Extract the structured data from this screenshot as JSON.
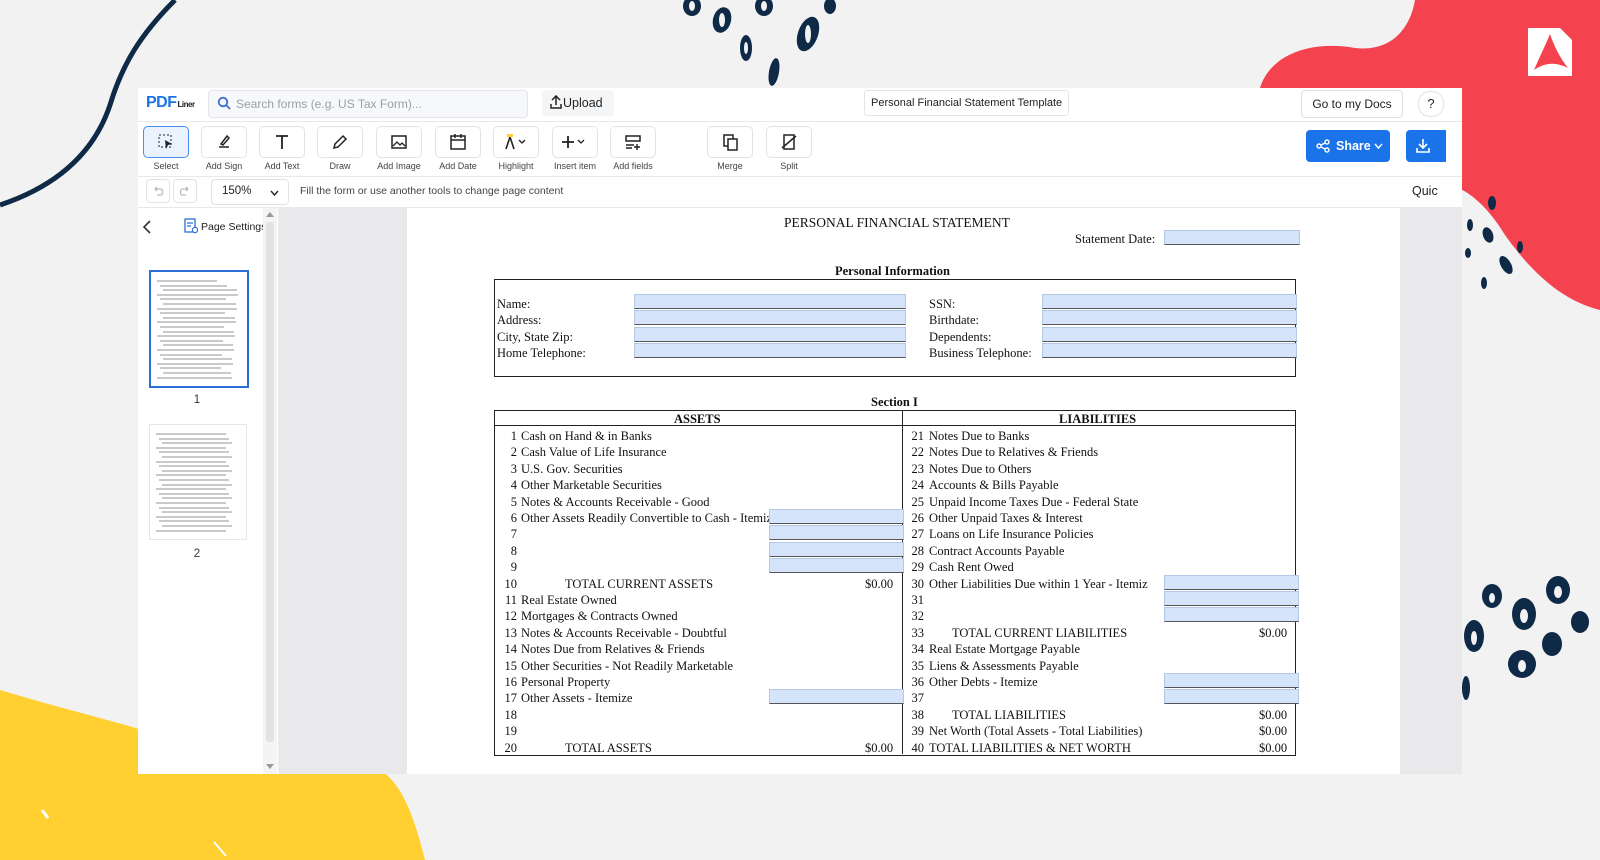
{
  "app": {
    "logo": {
      "text": "PDF",
      "suffix": "Liner"
    },
    "search": {
      "placeholder": "Search forms (e.g. US Tax Form)..."
    },
    "upload_label": "Upload",
    "document_title": "Personal Financial Statement Template",
    "go_to_docs_label": "Go to my Docs",
    "help_label": "?"
  },
  "toolbar": {
    "tools": [
      {
        "label": "Select",
        "icon": "select-icon"
      },
      {
        "label": "Add Sign",
        "icon": "sign-icon"
      },
      {
        "label": "Add Text",
        "icon": "text-icon"
      },
      {
        "label": "Draw",
        "icon": "pen-icon"
      },
      {
        "label": "Add Image",
        "icon": "image-icon"
      },
      {
        "label": "Add Date",
        "icon": "calendar-icon"
      },
      {
        "label": "Highlight",
        "icon": "highlight-icon"
      },
      {
        "label": "Insert item",
        "icon": "plus-icon"
      },
      {
        "label": "Add fields",
        "icon": "fields-icon"
      },
      {
        "label": "Merge",
        "icon": "merge-icon"
      },
      {
        "label": "Split",
        "icon": "split-icon"
      }
    ],
    "share_label": "Share"
  },
  "subbar": {
    "zoom": "150%",
    "hint": "Fill the form or use another tools to change page content",
    "quick_label": "Quic"
  },
  "sidebar": {
    "page_settings_label": "Page Settings",
    "pages": [
      "1",
      "2"
    ]
  },
  "form": {
    "title": "PERSONAL FINANCIAL STATEMENT",
    "statement_date_label": "Statement Date:",
    "personal_info_heading": "Personal Information",
    "personal_left": [
      "Name:",
      "Address:",
      "City, State Zip:",
      "Home Telephone:"
    ],
    "personal_right": [
      "SSN:",
      "Birthdate:",
      "Dependents:",
      "Business Telephone:"
    ],
    "section_heading": "Section I",
    "assets_heading": "ASSETS",
    "liabilities_heading": "LIABILITIES",
    "assets": [
      {
        "n": "1",
        "label": "Cash on Hand & in Banks"
      },
      {
        "n": "2",
        "label": "Cash Value of Life Insurance"
      },
      {
        "n": "3",
        "label": "U.S. Gov. Securities"
      },
      {
        "n": "4",
        "label": "Other Marketable Securities"
      },
      {
        "n": "5",
        "label": "Notes & Accounts Receivable - Good"
      },
      {
        "n": "6",
        "label": "Other Assets Readily Convertible to Cash - Itemize"
      },
      {
        "n": "7",
        "label": ""
      },
      {
        "n": "8",
        "label": ""
      },
      {
        "n": "9",
        "label": ""
      },
      {
        "n": "10",
        "label": "TOTAL CURRENT ASSETS",
        "value": "$0.00"
      },
      {
        "n": "11",
        "label": "Real Estate Owned"
      },
      {
        "n": "12",
        "label": "Mortgages & Contracts Owned"
      },
      {
        "n": "13",
        "label": "Notes & Accounts Receivable - Doubtful"
      },
      {
        "n": "14",
        "label": "Notes Due from Relatives & Friends"
      },
      {
        "n": "15",
        "label": "Other Securities - Not Readily Marketable"
      },
      {
        "n": "16",
        "label": "Personal Property"
      },
      {
        "n": "17",
        "label": "Other Assets - Itemize"
      },
      {
        "n": "18",
        "label": ""
      },
      {
        "n": "19",
        "label": ""
      },
      {
        "n": "20",
        "label": "TOTAL  ASSETS",
        "value": "$0.00"
      }
    ],
    "liabilities": [
      {
        "n": "21",
        "label": "Notes Due to Banks"
      },
      {
        "n": "22",
        "label": "Notes Due to Relatives & Friends"
      },
      {
        "n": "23",
        "label": "Notes Due to Others"
      },
      {
        "n": "24",
        "label": "Accounts & Bills Payable"
      },
      {
        "n": "25",
        "label": "Unpaid Income Taxes Due - Federal  State"
      },
      {
        "n": "26",
        "label": "Other Unpaid Taxes & Interest"
      },
      {
        "n": "27",
        "label": " Loans on Life Insurance Policies"
      },
      {
        "n": "28",
        "label": "Contract Accounts Payable"
      },
      {
        "n": "29",
        "label": "Cash Rent Owed"
      },
      {
        "n": "30",
        "label": "Other Liabilities Due within 1 Year - Itemiz"
      },
      {
        "n": "31",
        "label": ""
      },
      {
        "n": "32",
        "label": ""
      },
      {
        "n": "33",
        "label": "TOTAL CURRENT LIABILITIES",
        "value": "$0.00"
      },
      {
        "n": "34",
        "label": "Real Estate Mortgage Payable"
      },
      {
        "n": "35",
        "label": "Liens & Assessments Payable"
      },
      {
        "n": "36",
        "label": "Other Debts - Itemize"
      },
      {
        "n": "37",
        "label": ""
      },
      {
        "n": "38",
        "label": "TOTAL LIABILITIES",
        "value": "$0.00"
      },
      {
        "n": "39",
        "label": "Net Worth (Total Assets - Total Liabilities)",
        "value": "$0.00"
      },
      {
        "n": "40",
        "label": " TOTAL LIABILITIES & NET WORTH",
        "value": "$0.00"
      }
    ]
  },
  "colors": {
    "accent": "#1a73e8",
    "field": "#d6e4fb",
    "deco_red": "#f5424f",
    "deco_yellow": "#ffd02f",
    "deco_navy": "#0e2a47"
  }
}
